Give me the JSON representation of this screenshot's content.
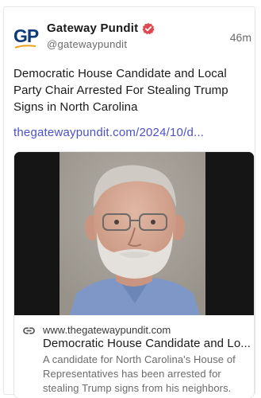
{
  "account": {
    "logo_text": "GP",
    "display_name": "Gateway Pundit",
    "handle": "@gatewaypundit",
    "timestamp": "46m"
  },
  "post": {
    "text": "Democratic House Candidate and Local Party Chair Arrested For Stealing Trump Signs in North Carolina",
    "link_text": "thegatewaypundit.com/2024/10/d..."
  },
  "link_card": {
    "domain": "www.thegatewaypundit.com",
    "title": "Democratic House Candidate and Lo...",
    "description": "A candidate for North Carolina's House of Representatives has been arrested for stealing Trump signs from his neighbors."
  },
  "colors": {
    "brand_navy": "#0f3b7a",
    "verified_badge": "#e0484f",
    "link": "#4b52c7",
    "mugshot_background": "#a8a39b",
    "shirt": "#7f97c6"
  }
}
